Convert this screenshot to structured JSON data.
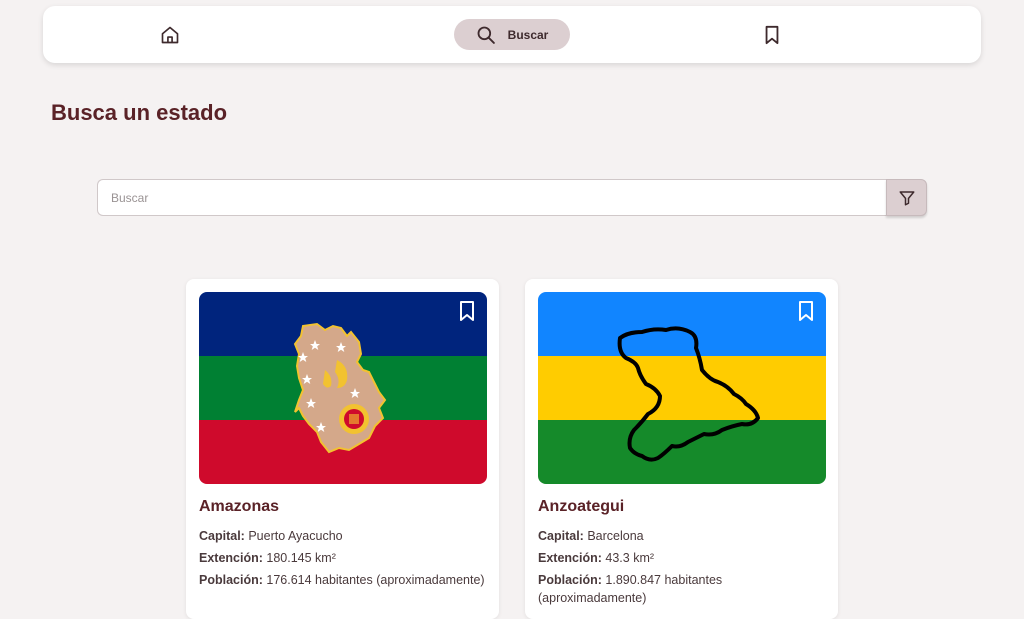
{
  "nav": {
    "home_icon": "home-icon",
    "search_label": "Buscar",
    "search_icon": "search-icon",
    "saved_icon": "bookmark-icon"
  },
  "page": {
    "title": "Busca un estado"
  },
  "search": {
    "placeholder": "Buscar",
    "value": "",
    "filter_icon": "filter-icon"
  },
  "colors": {
    "accent": "#5a2227",
    "nav_pill": "#dccfd1",
    "background": "#f5f2f2"
  },
  "states": [
    {
      "name": "Amazonas",
      "capital_label": "Capital:",
      "capital": "Puerto Ayacucho",
      "extension_label": "Extención:",
      "extension": "180.145 km²",
      "population_label": "Población:",
      "population": "176.614 habitantes (aproximadamente)",
      "flag_colors": [
        "#00247d",
        "#008033",
        "#cf0a2c"
      ]
    },
    {
      "name": "Anzoategui",
      "capital_label": "Capital:",
      "capital": "Barcelona",
      "extension_label": "Extención:",
      "extension": "43.3 km²",
      "population_label": "Población:",
      "population": "1.890.847 habitantes (aproximadamente)",
      "flag_colors": [
        "#1185ff",
        "#ffcc00",
        "#158a2a"
      ]
    }
  ]
}
